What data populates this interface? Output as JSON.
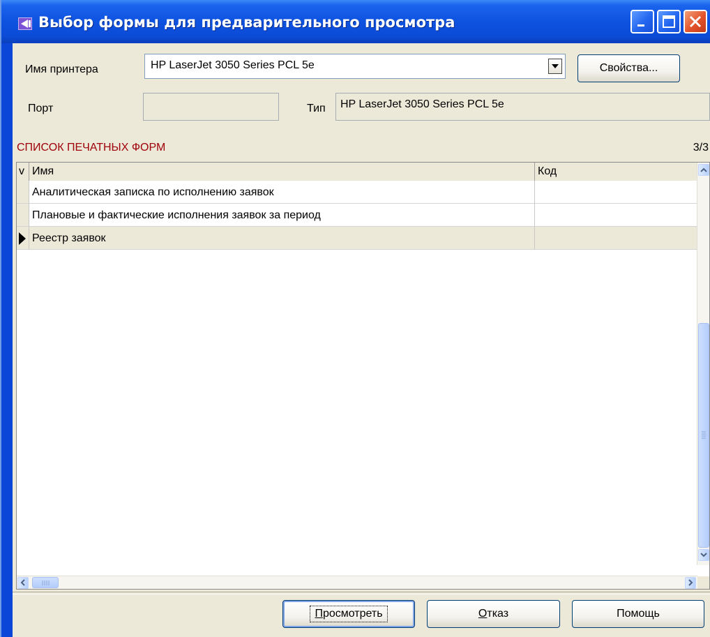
{
  "window": {
    "title": "Выбор формы для предварительного просмотра",
    "controls": [
      "minimize-icon",
      "maximize-icon",
      "close-icon"
    ]
  },
  "printer": {
    "name_label": "Имя принтера",
    "name_value": "HP LaserJet 3050 Series PCL 5e",
    "properties_button": "Свойства...",
    "port_label": "Порт",
    "port_value": "",
    "type_label": "Тип",
    "type_value": "HP LaserJet 3050 Series PCL 5e"
  },
  "forms": {
    "section_title": "СПИСОК ПЕЧАТНЫХ ФОРМ",
    "count": "3/3",
    "columns": {
      "check": "v",
      "name": "Имя",
      "code": "Код"
    },
    "rows": [
      {
        "name": "Аналитическая записка по исполнению заявок",
        "code": "",
        "selected": false
      },
      {
        "name": "Плановые и фактические исполнения заявок за период",
        "code": "",
        "selected": false
      },
      {
        "name": "Реестр заявок",
        "code": "",
        "selected": true
      }
    ]
  },
  "buttons": {
    "view_prefix": "П",
    "view_rest": "росмотреть",
    "cancel_prefix": "О",
    "cancel_rest": "тказ",
    "help": "Помощь"
  },
  "colors": {
    "titlebar": "#0b4bd6",
    "face": "#ece9d8",
    "section_title": "#a0000a",
    "close_button": "#e3532a"
  }
}
